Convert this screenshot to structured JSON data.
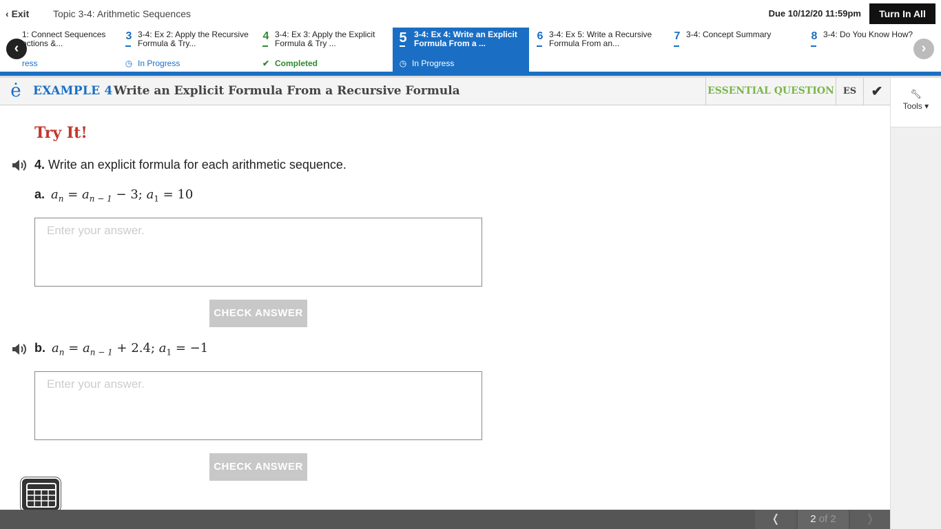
{
  "topbar": {
    "exit_label": "Exit",
    "topic_title": "Topic 3-4: Arithmetic Sequences",
    "due": "Due 10/12/20 11:59pm",
    "turn_in_label": "Turn In All"
  },
  "tabs": [
    {
      "num": "",
      "title": "1: Connect Sequences\nnctions &...",
      "status": "ress",
      "status_icon": ""
    },
    {
      "num": "3",
      "title": "3-4: Ex 2: Apply the Recursive Formula & Try...",
      "status": "In Progress",
      "status_icon": "clock-icon"
    },
    {
      "num": "4",
      "title": "3-4: Ex 3: Apply the Explicit Formula & Try ...",
      "status": "Completed",
      "status_icon": "checkmark-icon"
    },
    {
      "num": "5",
      "title": "3-4: Ex 4: Write an Explicit Formula From a ...",
      "status": "In Progress",
      "status_icon": "clock-icon"
    },
    {
      "num": "6",
      "title": "3-4: Ex 5: Write a Recursive Formula From an...",
      "status": "",
      "status_icon": ""
    },
    {
      "num": "7",
      "title": "3-4: Concept Summary",
      "status": "",
      "status_icon": ""
    },
    {
      "num": "8",
      "title": "3-4: Do You Know How?",
      "status": "",
      "status_icon": ""
    }
  ],
  "header": {
    "example_label": "EXAMPLE 4",
    "example_title": "Write an Explicit Formula From a Recursive Formula",
    "essential_label": "ESSENTIAL QUESTION",
    "es_label": "ES"
  },
  "tools_label": "Tools",
  "content": {
    "try_it": "Try It!",
    "q_number": "4.",
    "q_text": "Write an explicit formula for each arithmetic sequence.",
    "part_a_label": "a.",
    "part_b_label": "b.",
    "answer_placeholder": "Enter your answer.",
    "check_answer_label": "CHECK ANSWER"
  },
  "pager": {
    "current": "2",
    "of_text": "of 2"
  },
  "colors": {
    "brand_blue": "#1a6fc4",
    "completed_green": "#2d8a2d",
    "essential_green": "#7ab648",
    "try_it_red": "#c0392b"
  }
}
